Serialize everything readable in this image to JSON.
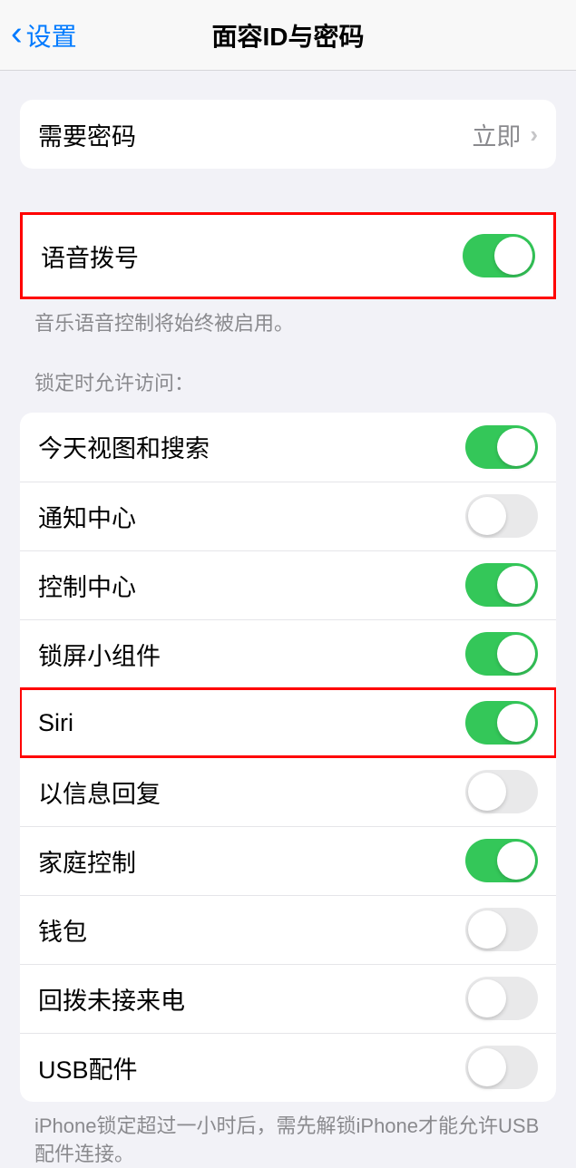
{
  "nav": {
    "back_label": "设置",
    "title": "面容ID与密码"
  },
  "passcode_row": {
    "label": "需要密码",
    "value": "立即"
  },
  "voice_dial": {
    "label": "语音拨号",
    "footer": "音乐语音控制将始终被启用。"
  },
  "locked_section": {
    "header": "锁定时允许访问：",
    "items": [
      {
        "label": "今天视图和搜索",
        "on": true
      },
      {
        "label": "通知中心",
        "on": false
      },
      {
        "label": "控制中心",
        "on": true
      },
      {
        "label": "锁屏小组件",
        "on": true
      },
      {
        "label": "Siri",
        "on": true
      },
      {
        "label": "以信息回复",
        "on": false
      },
      {
        "label": "家庭控制",
        "on": true
      },
      {
        "label": "钱包",
        "on": false
      },
      {
        "label": "回拨未接来电",
        "on": false
      },
      {
        "label": "USB配件",
        "on": false
      }
    ],
    "footer": "iPhone锁定超过一小时后，需先解锁iPhone才能允许USB配件连接。"
  }
}
